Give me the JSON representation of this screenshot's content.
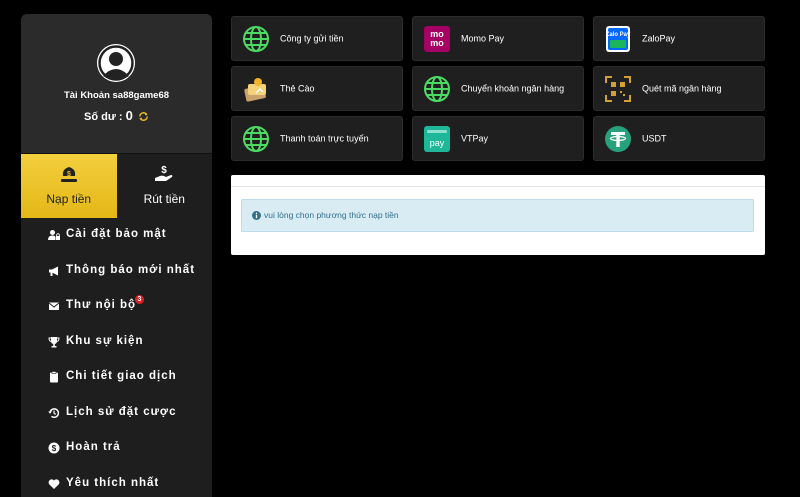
{
  "account": {
    "label": "Tài Khoản sa88game68",
    "balance_label": "Số dư :",
    "balance_value": "0"
  },
  "tabs": [
    {
      "label": "Nạp tiền",
      "active": true,
      "icon": "money-bag-icon"
    },
    {
      "label": "Rút tiền",
      "active": false,
      "icon": "hand-dollar-icon"
    }
  ],
  "menu": [
    {
      "label": "Cài đặt bảo mật",
      "icon": "user-lock-icon"
    },
    {
      "label": "Thông báo mới nhất",
      "icon": "bullhorn-icon"
    },
    {
      "label": "Thư nội bộ",
      "icon": "envelope-icon",
      "badge": "3"
    },
    {
      "label": "Khu sự kiện",
      "icon": "trophy-icon"
    },
    {
      "label": "Chi tiết giao dịch",
      "icon": "clipboard-icon"
    },
    {
      "label": "Lịch sử đặt cược",
      "icon": "history-icon"
    },
    {
      "label": "Hoàn trả",
      "icon": "dollar-circle-icon"
    },
    {
      "label": "Yêu thích nhất",
      "icon": "heart-icon"
    }
  ],
  "payment_methods": [
    {
      "label": "Công ty gửi tiền",
      "icon": "globe-icon"
    },
    {
      "label": "Momo Pay",
      "icon": "momo-icon",
      "icon_text": "mo mo"
    },
    {
      "label": "ZaloPay",
      "icon": "zalopay-icon",
      "icon_text": "Zalo Pay"
    },
    {
      "label": "Thẻ Cào",
      "icon": "scratch-card-icon"
    },
    {
      "label": "Chuyển khoản ngân hàng",
      "icon": "globe-icon"
    },
    {
      "label": "Quét mã ngân hàng",
      "icon": "qr-scan-icon"
    },
    {
      "label": "Thanh toán trực tuyến",
      "icon": "globe-icon"
    },
    {
      "label": "VTPay",
      "icon": "vtpay-icon",
      "icon_text": "pay"
    },
    {
      "label": "USDT",
      "icon": "tether-icon"
    }
  ],
  "notice": {
    "text": "vui lòng chọn phương thức nạp tiền"
  },
  "colors": {
    "accent_yellow": "#e9bf22",
    "globe_green": "#4cd964",
    "momo_pink": "#a50064",
    "zalo_blue": "#0068ff",
    "tether_green": "#26a17b",
    "alert_bg": "#d9ecf4",
    "alert_text": "#31708f"
  }
}
